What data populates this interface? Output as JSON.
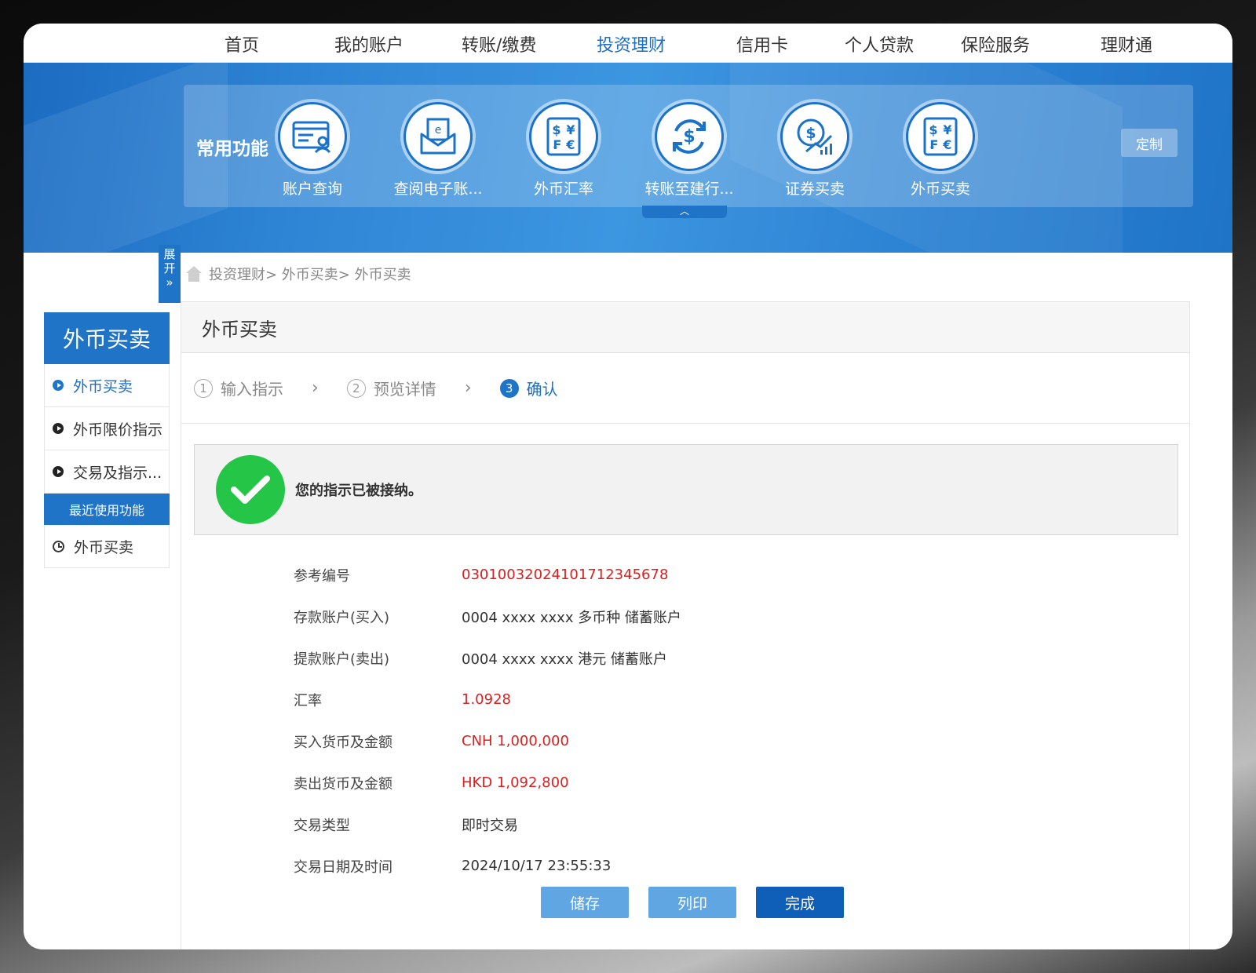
{
  "nav": [
    "首页",
    "我的账户",
    "转账/缴费",
    "投资理财",
    "信用卡",
    "个人贷款",
    "保险服务",
    "理财通"
  ],
  "nav_active_index": 3,
  "quick": {
    "title": "常用功能",
    "items": [
      {
        "label": "账户查询",
        "icon": "account-card-icon"
      },
      {
        "label": "查阅电子账...",
        "icon": "e-statement-icon"
      },
      {
        "label": "外币汇率",
        "icon": "currency-symbols-icon"
      },
      {
        "label": "转账至建行...",
        "icon": "transfer-dollar-icon"
      },
      {
        "label": "证券买卖",
        "icon": "securities-trading-icon"
      },
      {
        "label": "外币买卖",
        "icon": "currency-symbols-icon"
      }
    ],
    "custom_label": "定制",
    "collapse_glyph": "︿"
  },
  "expand_tab": {
    "line1": "展",
    "line2": "开",
    "chev": "»"
  },
  "breadcrumb": "投资理财> 外币买卖> 外币买卖",
  "sidebar": {
    "title": "外币买卖",
    "items": [
      "外币买卖",
      "外币限价指示",
      "交易及指示..."
    ],
    "recent_title": "最近使用功能",
    "recent_items": [
      "外币买卖"
    ]
  },
  "page": {
    "title": "外币买卖",
    "steps": [
      {
        "num": "1",
        "label": "输入指示"
      },
      {
        "num": "2",
        "label": "预览详情"
      },
      {
        "num": "3",
        "label": "确认"
      }
    ],
    "step_sep": "›",
    "success_message": "您的指示已被接纳。",
    "details": [
      {
        "key": "参考编号",
        "value": "0301003202410171234567​8"
      },
      {
        "key": "存款账户(买入)",
        "value": "0004 xxxx xxxx   多币种 储蓄账户"
      },
      {
        "key": "提款账户(卖出)",
        "value": "0004 xxxx xxxx   港元 储蓄账户"
      },
      {
        "key": "汇率",
        "value": "1.0928"
      },
      {
        "key": "买入货币及金额",
        "value": "CNH 1,000,000"
      },
      {
        "key": "卖出货币及金额",
        "value": "HKD 1,092,800"
      },
      {
        "key": "交易类型",
        "value": "即时交易"
      },
      {
        "key": "交易日期及时间",
        "value": "2024/10/17 23:55:33"
      }
    ],
    "buttons": {
      "save": "储存",
      "print": "列印",
      "done": "完成"
    }
  },
  "colors": {
    "brand": "#1f74c8",
    "accent_text": "#1b6fc4",
    "highlight": "#d92020",
    "success": "#25c548"
  }
}
